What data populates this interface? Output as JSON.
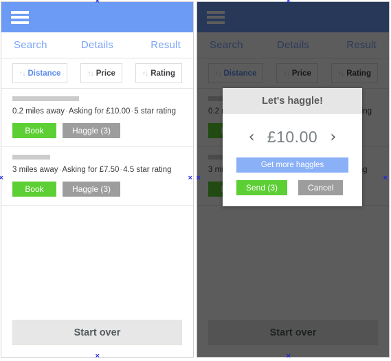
{
  "appbar": {
    "menu_icon": "hamburger-menu-icon"
  },
  "tabs": [
    {
      "label": "Search"
    },
    {
      "label": "Details"
    },
    {
      "label": "Result"
    }
  ],
  "sort": {
    "arrows_glyph": "↑↓",
    "buttons": [
      {
        "label": "Distance",
        "active": true
      },
      {
        "label": "Price",
        "active": false
      },
      {
        "label": "Rating",
        "active": false
      }
    ]
  },
  "listings": [
    {
      "meta_distance": "0.2 miles away",
      "meta_price": "Asking for £10.00",
      "meta_rating": "5 star rating",
      "separator": "·",
      "book_label": "Book",
      "haggle_label": "Haggle (3)"
    },
    {
      "meta_distance": "3 miles away",
      "meta_price": "Asking for £7.50",
      "meta_rating": "4.5 star rating",
      "separator": "·",
      "book_label": "Book",
      "haggle_label": "Haggle (3)"
    }
  ],
  "footer": {
    "start_over_label": "Start over"
  },
  "modal": {
    "title": "Let's haggle!",
    "prev_glyph": "‹",
    "next_glyph": "›",
    "price_value": "£10.00",
    "get_more_label": "Get more haggles",
    "send_label": "Send (3)",
    "cancel_label": "Cancel"
  },
  "colors": {
    "appbar_blue": "#6c9bf5",
    "appbar_dim": "#1e2744",
    "tab_blue": "#7aa4f7",
    "green": "#5ccf34",
    "gray": "#9d9d9d",
    "modal_head": "#e6e6e6",
    "light_blue": "#8ab0f7",
    "handle_blue": "#1a1af0"
  }
}
